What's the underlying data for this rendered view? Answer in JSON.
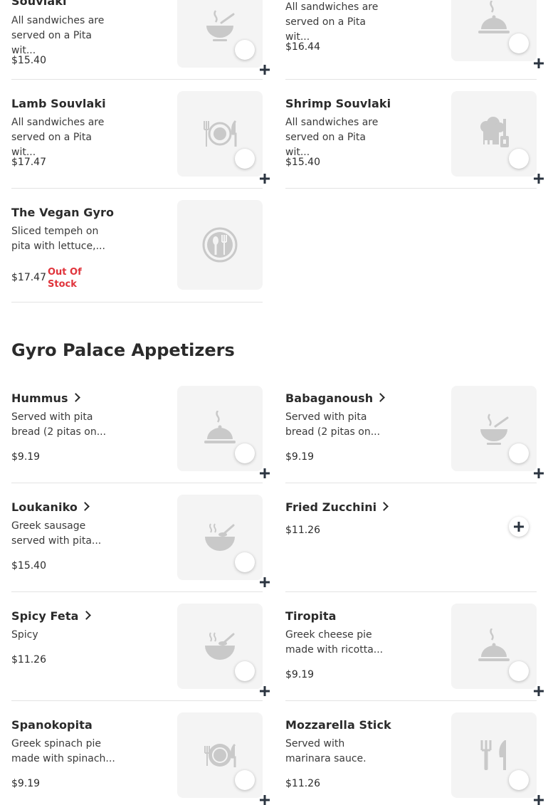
{
  "section1": {
    "items": [
      {
        "name": "Souvlaki",
        "desc": "All sandwiches are served on a Pita wit...",
        "price": "$15.40"
      },
      {
        "name": "",
        "desc": "All sandwiches are served on a Pita wit...",
        "price": "$16.44"
      },
      {
        "name": "Lamb Souvlaki",
        "desc": "All sandwiches are served on a Pita wit...",
        "price": "$17.47"
      },
      {
        "name": "Shrimp Souvlaki",
        "desc": "All sandwiches are served on a Pita wit...",
        "price": "$15.40"
      },
      {
        "name": "The Vegan Gyro",
        "desc": "Sliced tempeh on pita with lettuce,...",
        "price": "$17.47",
        "status": "Out Of Stock"
      }
    ]
  },
  "section2": {
    "title": "Gyro Palace Appetizers",
    "items": [
      {
        "name": "Hummus",
        "desc": "Served with pita bread (2 pitas on...",
        "price": "$9.19",
        "icon": "cloche-icon"
      },
      {
        "name": "Babaganoush",
        "desc": "Served with pita bread (2 pitas on...",
        "price": "$9.19",
        "icon": "soup-bowl-icon"
      },
      {
        "name": "Loukaniko",
        "desc": "Greek sausage served with pita...",
        "price": "$15.40",
        "icon": "bowl-spoon-icon"
      },
      {
        "name": "Fried Zucchini",
        "desc": "",
        "price": "$11.26"
      },
      {
        "name": "Spicy Feta",
        "desc": "Spicy",
        "price": "$11.26",
        "icon": "bowl-spoon-icon"
      },
      {
        "name": "Tiropita",
        "desc": "Greek cheese pie made with ricotta...",
        "price": "$9.19",
        "icon": "cloche-icon"
      },
      {
        "name": "Spanokopita",
        "desc": "Greek spinach pie made with spinach...",
        "price": "$9.19",
        "icon": "plate-cutlery-icon"
      },
      {
        "name": "Mozzarella Stick",
        "desc": "Served with marinara sauce.",
        "price": "$11.26",
        "icon": "fork-knife-icon"
      }
    ]
  },
  "colors": {
    "accent": "#e0333b",
    "text": "#2b2b2b",
    "thumb_bg": "#f4f4f4",
    "icon": "#c9c9c9"
  }
}
